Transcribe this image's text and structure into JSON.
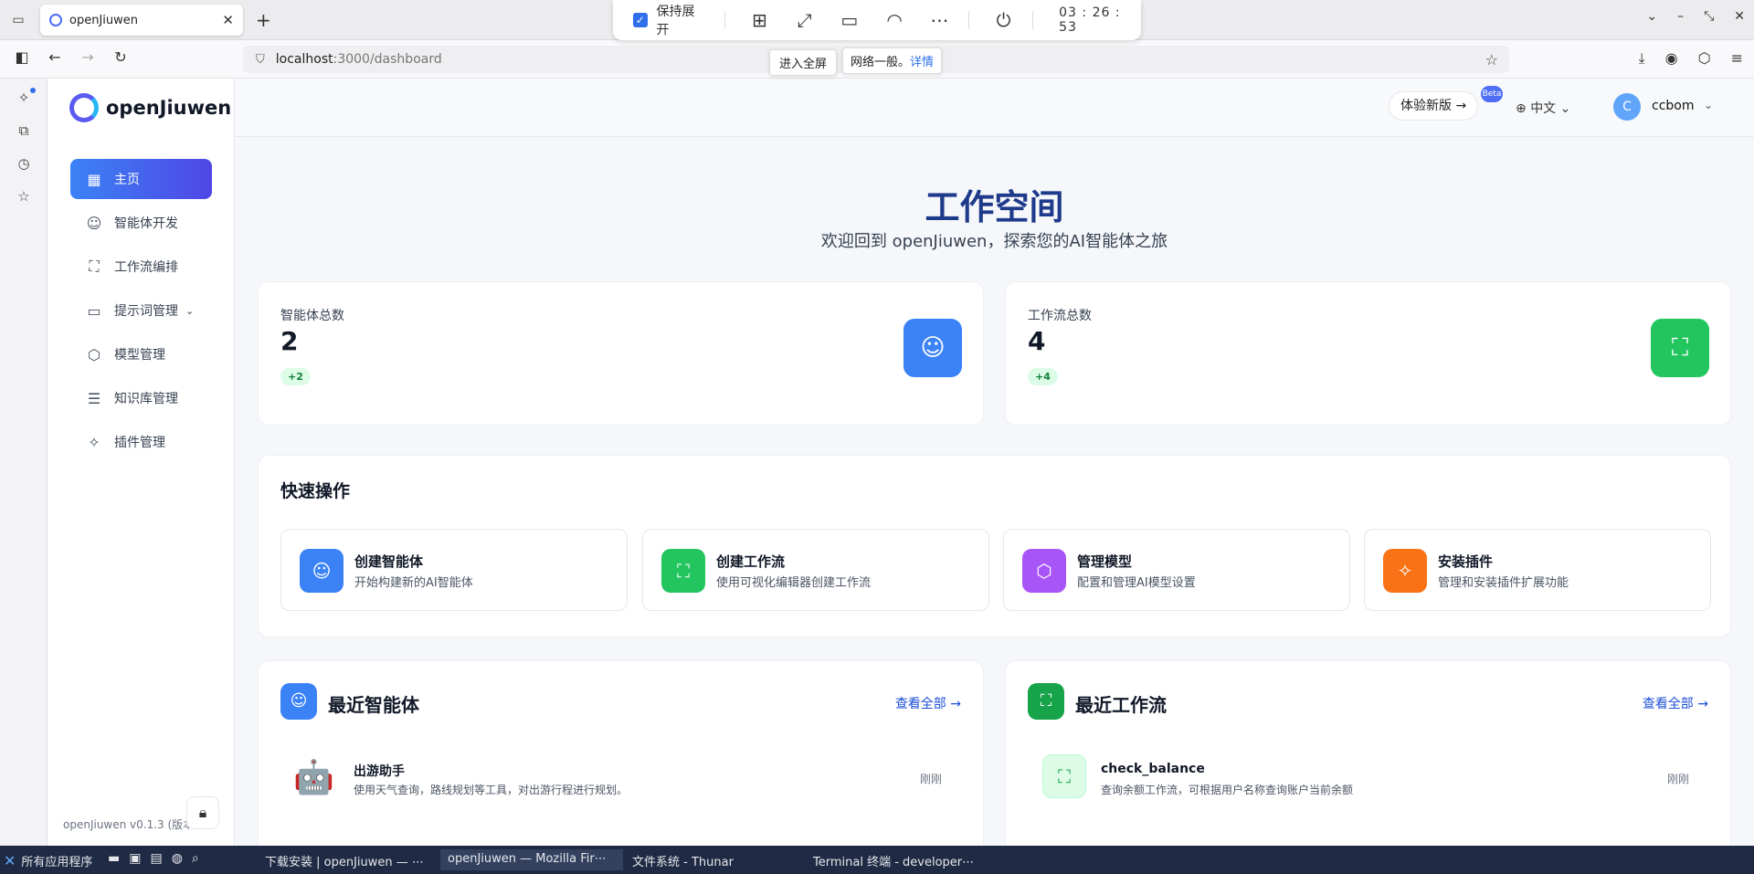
{
  "browser": {
    "tab_title": "openJiuwen",
    "url_host": "localhost",
    "url_path": ":3000/dashboard"
  },
  "remote_toolbar": {
    "keep_expanded_label": "保持展开",
    "timer": "03 : 26 : 53",
    "tooltip_fullscreen": "进入全屏",
    "tooltip_network": "网络一般。",
    "tooltip_network_link": "详情"
  },
  "sidebar": {
    "logo_text": "openJiuwen",
    "items": [
      {
        "label": "主页",
        "icon": "dashboard-icon"
      },
      {
        "label": "智能体开发",
        "icon": "robot-icon"
      },
      {
        "label": "工作流编排",
        "icon": "workflow-icon"
      },
      {
        "label": "提示词管理",
        "icon": "message-icon"
      },
      {
        "label": "模型管理",
        "icon": "model-icon"
      },
      {
        "label": "知识库管理",
        "icon": "database-icon"
      },
      {
        "label": "插件管理",
        "icon": "puzzle-icon"
      }
    ],
    "version": "openJiuwen v0.1.3 (版本"
  },
  "header": {
    "try_new_label": "体验新版",
    "beta_label": "Beta",
    "language": "中文",
    "avatar_letter": "C",
    "username": "ccbom"
  },
  "main": {
    "title": "工作空间",
    "subtitle": "欢迎回到 openJiuwen，探索您的AI智能体之旅",
    "stats": [
      {
        "label": "智能体总数",
        "value": "2",
        "delta": "+2",
        "icon": "robot-icon",
        "color": "#3b82f6"
      },
      {
        "label": "工作流总数",
        "value": "4",
        "delta": "+4",
        "icon": "workflow-icon",
        "color": "#22c55e"
      }
    ],
    "quick_actions": {
      "title": "快速操作",
      "items": [
        {
          "name": "创建智能体",
          "desc": "开始构建新的AI智能体",
          "icon": "robot-icon",
          "color": "#3b82f6"
        },
        {
          "name": "创建工作流",
          "desc": "使用可视化编辑器创建工作流",
          "icon": "workflow-icon",
          "color": "#22c55e"
        },
        {
          "name": "管理模型",
          "desc": "配置和管理AI模型设置",
          "icon": "model-icon",
          "color": "#a855f7"
        },
        {
          "name": "安装插件",
          "desc": "管理和安装插件扩展功能",
          "icon": "puzzle-icon",
          "color": "#f97316"
        }
      ]
    },
    "recent_agents": {
      "title": "最近智能体",
      "view_all": "查看全部 →",
      "items": [
        {
          "name": "出游助手",
          "desc": "使用天气查询，路线规划等工具，对出游行程进行规划。",
          "time": "刚刚",
          "icon": "robot-emoji-icon"
        }
      ]
    },
    "recent_workflows": {
      "title": "最近工作流",
      "view_all": "查看全部 →",
      "items": [
        {
          "name": "check_balance",
          "desc": "查询余额工作流，可根据用户名称查询账户当前余额",
          "time": "刚刚",
          "icon": "workflow-icon"
        }
      ]
    }
  },
  "taskbar": {
    "start_label": "所有应用程序",
    "tasks": [
      {
        "label": "下载安装 | openJiuwen — ⋯",
        "active": false
      },
      {
        "label": "openJiuwen — Mozilla Fir⋯",
        "active": true
      },
      {
        "label": "文件系统 - Thunar",
        "active": false
      },
      {
        "label": "Terminal 终端 - developer⋯",
        "active": false
      }
    ]
  }
}
